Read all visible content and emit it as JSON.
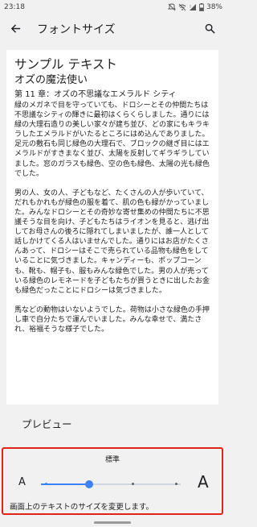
{
  "status": {
    "time": "23:18",
    "battery": "38%"
  },
  "header": {
    "title": "フォントサイズ"
  },
  "preview": {
    "sample_title": "サンプル テキスト",
    "book_title": "オズの魔法使い",
    "chapter_title": "第 11 章：オズの不思議なエメラルド シティ",
    "paragraphs": [
      "緑のメガネで目を守っていても、ドロシーとその仲間たちは不思議なシティの輝きに最初はくらくらしました。通りには緑の大理石造りの美しい家々が建ち並び、どの家にもキラキラしたエメラルドがいたるところにはめ込んでありました。足元の敷石も同じ緑色の大理石で、ブロックの継ぎ目にはエメラルドがすきまなく並び、太陽を反射してギラギラしていました。窓のガラスも緑色、空の色も緑色、太陽の光も緑色でした。",
      "男の人、女の人、子どもなど、たくさんの人が歩いていて、だれもかれもが緑色の服を着て、肌の色も緑がかっていました。みんなドロシーとその奇妙な寄せ集めの仲間たちに不思議そうな目を向け、子どもたちはライオンを見ると、逃げ出してお母さんの後ろに隠れてしまいましたが、誰一人として話しかけてくる人はいませんでした。通りにはお店がたくさんあって、ドロシーはそこで売られている品物も緑色をしていることに気づきました。キャンディーも、ポップコーンも、靴も、帽子も、服もみんな緑色でした。男の人が売っている緑色のレモネードを子どもたちが買うときに出したお金も緑色だったことにドロシーは気づきました。",
      "馬などの動物はいないようでした。荷物は小さな緑色の手押し車で自分たちで運んでいました。みんな幸せで、満たされ、裕福そうな様子でした。"
    ],
    "label": "プレビュー"
  },
  "size_control": {
    "current_size": "標準",
    "small_glyph": "A",
    "large_glyph": "A",
    "description": "画面上のテキストのサイズを変更します。",
    "level_index": 1,
    "level_count": 4
  },
  "colors": {
    "accent": "#3b82f6",
    "highlight_border": "#e2231a"
  }
}
